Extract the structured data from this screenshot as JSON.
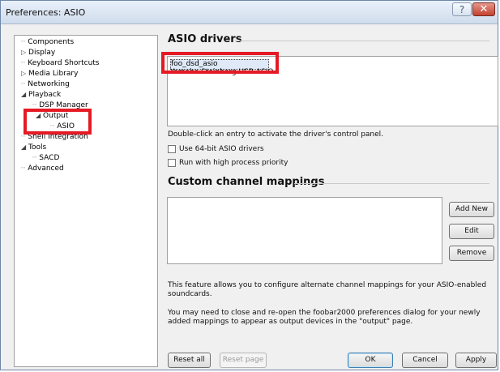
{
  "window": {
    "title": "Preferences: ASIO",
    "help_glyph": "?",
    "close_glyph": "✕"
  },
  "tree": {
    "items": [
      {
        "label": "Components"
      },
      {
        "label": "Display"
      },
      {
        "label": "Keyboard Shortcuts"
      },
      {
        "label": "Media Library"
      },
      {
        "label": "Networking"
      },
      {
        "label": "Playback"
      },
      {
        "label": "DSP Manager"
      },
      {
        "label": "Output"
      },
      {
        "label": "ASIO"
      },
      {
        "label": "Shell Integration"
      },
      {
        "label": "Tools"
      },
      {
        "label": "SACD"
      },
      {
        "label": "Advanced"
      }
    ]
  },
  "asio": {
    "section_title": "ASIO drivers",
    "drivers": [
      "foo_dsd_asio",
      "Yamaha Steinberg USB ASIO"
    ],
    "hint": "Double-click an entry to activate the driver's control panel.",
    "opt_64bit": "Use 64-bit ASIO drivers",
    "opt_priority": "Run with high process priority"
  },
  "mappings": {
    "section_title": "Custom channel mappings",
    "add_new": "Add New",
    "edit": "Edit",
    "remove": "Remove",
    "desc1": "This feature allows you to configure alternate channel mappings for your ASIO-enabled",
    "desc1b": "soundcards.",
    "desc2": "You may need to close and re-open the foobar2000 preferences dialog for your newly",
    "desc2b": "added mappings to appear as output devices in the \"output\" page."
  },
  "footer": {
    "reset_all": "Reset all",
    "reset_page": "Reset page",
    "ok": "OK",
    "cancel": "Cancel",
    "apply": "Apply"
  },
  "colors": {
    "highlight": "#e51a24"
  }
}
